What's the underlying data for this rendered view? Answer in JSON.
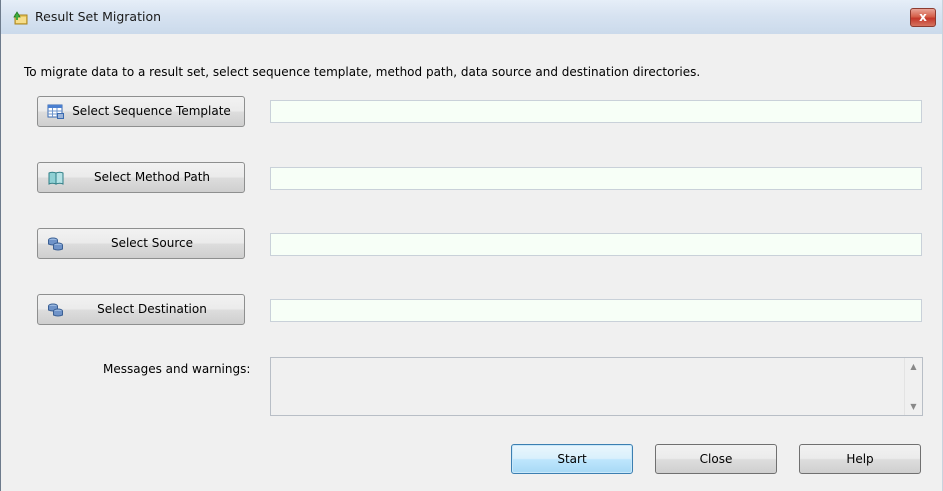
{
  "window": {
    "title": "Result Set Migration",
    "close_label": "x"
  },
  "instruction": "To migrate data to a result set, select sequence template, method path, data source and destination directories.",
  "selectors": [
    {
      "label": "Select Sequence Template",
      "icon": "table-grid-icon",
      "value": ""
    },
    {
      "label": "Select Method Path",
      "icon": "book-icon",
      "value": ""
    },
    {
      "label": "Select Source",
      "icon": "database-icon",
      "value": ""
    },
    {
      "label": "Select Destination",
      "icon": "database-icon",
      "value": ""
    }
  ],
  "messages": {
    "label": "Messages and warnings:",
    "text": ""
  },
  "buttons": {
    "start": "Start",
    "close": "Close",
    "help": "Help"
  },
  "colors": {
    "path_field_bg": "#f7fff7",
    "default_button_border": "#3c7fb1"
  }
}
